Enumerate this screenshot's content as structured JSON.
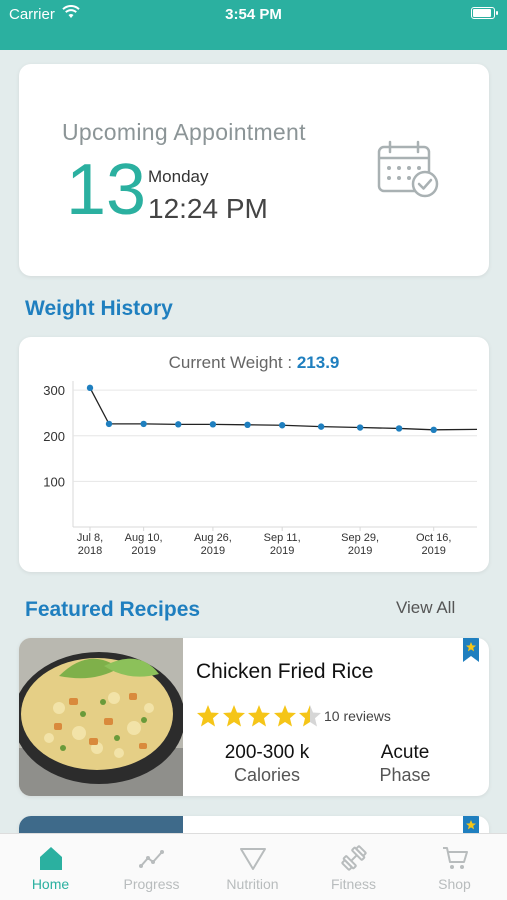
{
  "status_bar": {
    "carrier": "Carrier",
    "time": "3:54 PM"
  },
  "appointment": {
    "title": "Upcoming Appointment",
    "day": "13",
    "weekday": "Monday",
    "time": "12:24 PM",
    "icon": "calendar-check-icon"
  },
  "weight_section": {
    "title": "Weight History",
    "current_label": "Current Weight :",
    "current_value": "213.9"
  },
  "chart_data": {
    "type": "line",
    "y_ticks": [
      "300",
      "200",
      "100"
    ],
    "ylim": [
      0,
      320
    ],
    "x_tick_labels": [
      [
        "Jul 8,",
        "2018"
      ],
      [
        "Aug 10,",
        "2019"
      ],
      [
        "Aug 26,",
        "2019"
      ],
      [
        "Sep 11,",
        "2019"
      ],
      [
        "Sep 29,",
        "2019"
      ],
      [
        "Oct 16,",
        "2019"
      ]
    ],
    "x": [
      "Jul 8, 2018",
      "Aug 2, 2019",
      "Aug 10, 2019",
      "Aug 18, 2019",
      "Aug 26, 2019",
      "Sep 3, 2019",
      "Sep 11, 2019",
      "Sep 20, 2019",
      "Sep 29, 2019",
      "Oct 8, 2019",
      "Oct 16, 2019",
      "Oct 26, 2019"
    ],
    "values": [
      305,
      226,
      226,
      225,
      225,
      224,
      223,
      220,
      218,
      216,
      213,
      213.9
    ],
    "markers": [
      true,
      true,
      true,
      true,
      true,
      true,
      true,
      true,
      true,
      true,
      true,
      false
    ],
    "grid": true,
    "line_color": "#222222",
    "point_color": "#1f7fbf"
  },
  "recipes_section": {
    "title": "Featured Recipes",
    "view_all": "View All"
  },
  "recipes": [
    {
      "name": "Chicken Fried Rice",
      "rating": 4.5,
      "reviews": "10 reviews",
      "calories_value": "200-300 k",
      "calories_label": "Calories",
      "phase_value": "Acute",
      "phase_label": "Phase"
    }
  ],
  "tab_bar": {
    "tabs": [
      {
        "label": "Home",
        "icon": "home-icon",
        "active": true
      },
      {
        "label": "Progress",
        "icon": "progress-chart-icon",
        "active": false
      },
      {
        "label": "Nutrition",
        "icon": "nutrition-triangle-icon",
        "active": false
      },
      {
        "label": "Fitness",
        "icon": "dumbbell-icon",
        "active": false
      },
      {
        "label": "Shop",
        "icon": "shopping-cart-icon",
        "active": false
      }
    ]
  },
  "colors": {
    "accent": "#2bb0a0",
    "link_blue": "#1f7fbf",
    "star_gold": "#f5c518",
    "background": "#e3ecec"
  }
}
